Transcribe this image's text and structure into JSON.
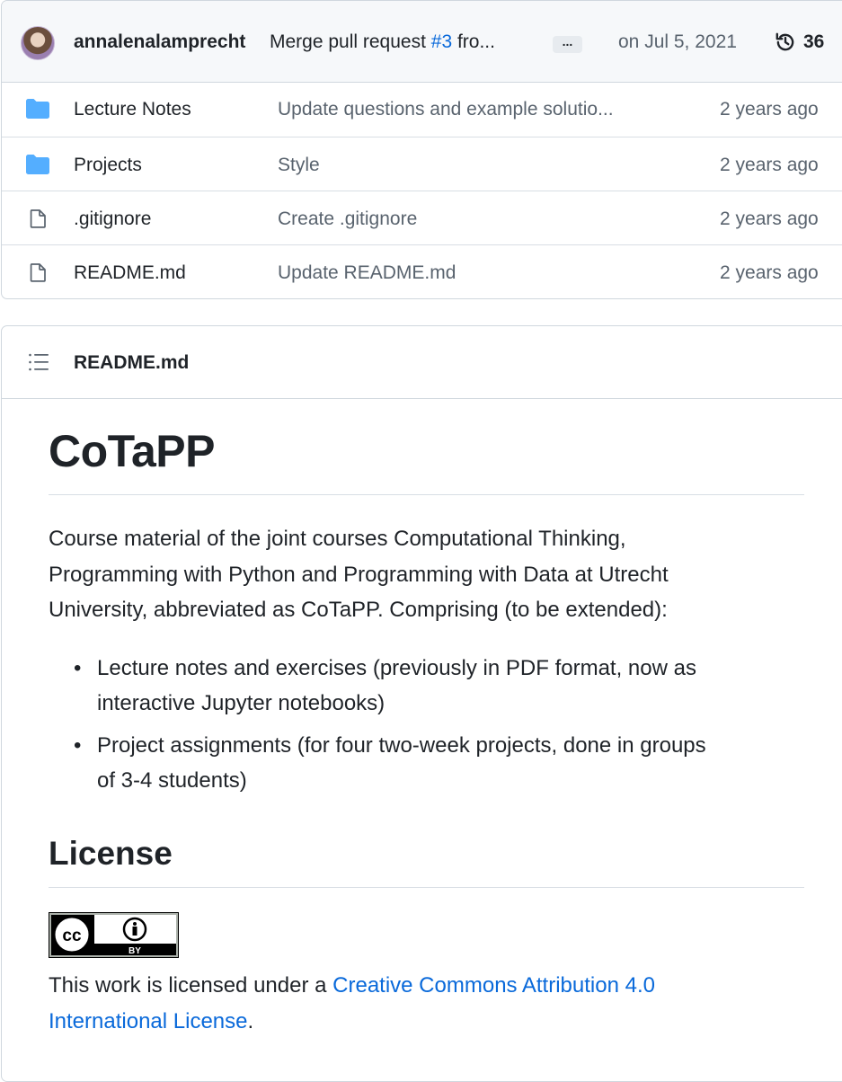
{
  "latest_commit": {
    "author": "annalenalamprecht",
    "message_prefix": "Merge pull request ",
    "pr_link": "#3",
    "message_suffix": " fro...",
    "ellipsis": "...",
    "date": "on Jul 5, 2021",
    "commit_count": "36"
  },
  "files": [
    {
      "name": "Lecture Notes",
      "type": "folder",
      "message": "Update questions and example solutio...",
      "age": "2 years ago"
    },
    {
      "name": "Projects",
      "type": "folder",
      "message": "Style",
      "age": "2 years ago"
    },
    {
      "name": ".gitignore",
      "type": "file",
      "message": "Create .gitignore",
      "age": "2 years ago"
    },
    {
      "name": "README.md",
      "type": "file",
      "message": "Update README.md",
      "age": "2 years ago"
    }
  ],
  "readme": {
    "header": "README.md",
    "title": "CoTaPP",
    "intro_lines": [
      "Course material of the joint courses Computational Thinking,",
      "Programming with Python and Programming with Data at Utrecht",
      "University, abbreviated as CoTaPP. Comprising (to be extended):"
    ],
    "bullets": [
      {
        "line1": "Lecture notes and exercises (previously in PDF format, now as",
        "line2": "interactive Jupyter notebooks)"
      },
      {
        "line1": "Project assignments (for four two-week projects, done in groups",
        "line2": "of 3-4 students)"
      }
    ],
    "license_heading": "License",
    "badge_text": {
      "cc": "cc",
      "by": "BY"
    },
    "license_prefix": "This work is licensed under a ",
    "license_link_line1": "Creative Commons Attribution 4.0",
    "license_link_line2": "International License",
    "license_suffix": "."
  },
  "colors": {
    "folder": "#54aeff",
    "link": "#0969da",
    "muted": "#59636e"
  }
}
